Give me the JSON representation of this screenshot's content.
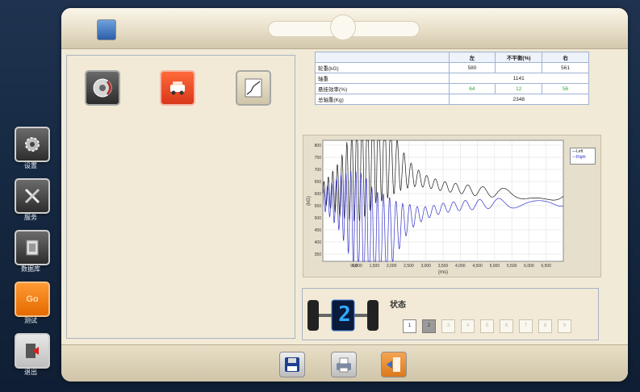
{
  "sidebar": {
    "items": [
      {
        "label": "设置",
        "icon": "gear-icon"
      },
      {
        "label": "服务",
        "icon": "tools-icon"
      },
      {
        "label": "数据库",
        "icon": "database-icon"
      },
      {
        "label": "测试",
        "icon": "go-icon",
        "icon_text": "Go"
      },
      {
        "label": "退出",
        "icon": "exit-icon"
      }
    ]
  },
  "tools": [
    {
      "icon": "brake-disc-icon"
    },
    {
      "icon": "car-front-icon",
      "active": true
    },
    {
      "icon": "suspension-curve-icon"
    }
  ],
  "summary": {
    "headers": [
      "",
      "左",
      "不平衡(%)",
      "右"
    ],
    "rows": [
      [
        "轮重(kG)",
        "580",
        "",
        "561"
      ],
      [
        "轴重",
        "1141"
      ],
      [
        "悬挂效率(%)",
        "64",
        "12",
        "56"
      ],
      [
        "总轴重(Kg)",
        "2348"
      ]
    ]
  },
  "status": {
    "title": "状态",
    "step_display": "2",
    "steps": [
      "1",
      "2",
      "3",
      "4",
      "5",
      "6",
      "7",
      "8",
      "9"
    ],
    "current_step": 2
  },
  "chart_data": {
    "type": "line",
    "title": "",
    "xlabel": "(ms)",
    "ylabel": "(kG)",
    "xlim": [
      0,
      7000
    ],
    "ylim": [
      320,
      820
    ],
    "x_ticks": [
      900,
      1000,
      1500,
      2000,
      2500,
      3000,
      3500,
      4000,
      4500,
      5000,
      5500,
      6000,
      6500
    ],
    "x_tick_labels": [
      "900",
      "1,000",
      "1,500",
      "2,000",
      "2,500",
      "3,000",
      "3,500",
      "4,000",
      "4,500",
      "5,000",
      "5,500",
      "6,000",
      "6,500"
    ],
    "y_ticks": [
      350,
      400,
      450,
      500,
      550,
      600,
      650,
      700,
      750,
      800
    ],
    "grid": true,
    "legend": "top-right",
    "series": [
      {
        "name": "Left",
        "color": "#1a1a1a",
        "x": [
          0,
          500,
          1000,
          1500,
          2000,
          2500,
          3000,
          3500,
          4000,
          4500,
          5000,
          5500,
          6000,
          6500,
          7000
        ],
        "y": [
          600,
          620,
          700,
          790,
          730,
          680,
          650,
          630,
          620,
          610,
          605,
          600,
          598,
          595,
          590
        ]
      },
      {
        "name": "Right",
        "color": "#3333cc",
        "x": [
          0,
          500,
          1000,
          1500,
          2000,
          2500,
          3000,
          3500,
          4000,
          4500,
          5000,
          5500,
          6000,
          6500,
          7000
        ],
        "y": [
          580,
          560,
          480,
          380,
          440,
          500,
          520,
          540,
          550,
          555,
          560,
          560,
          562,
          565,
          568
        ]
      }
    ]
  },
  "bottom": {
    "buttons": [
      {
        "icon": "save-icon"
      },
      {
        "icon": "print-icon"
      },
      {
        "icon": "exit-door-icon"
      }
    ]
  }
}
